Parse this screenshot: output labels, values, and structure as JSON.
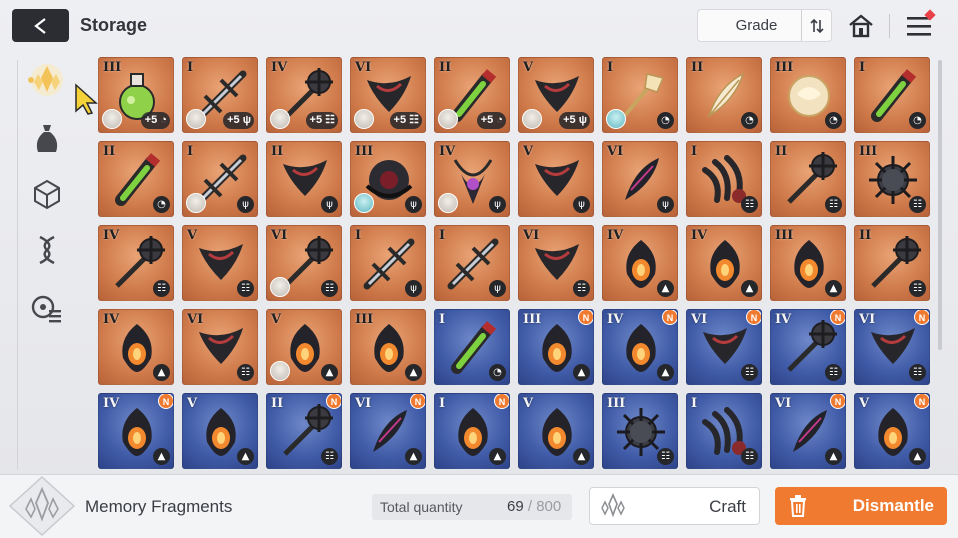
{
  "header": {
    "title": "Storage",
    "sort_label": "Grade"
  },
  "sidebar": {
    "items": [
      {
        "name": "memory-fragments-tab",
        "icon": "crystal-icon",
        "active": true
      },
      {
        "name": "bag-tab",
        "icon": "bag-icon",
        "active": false
      },
      {
        "name": "materials-tab",
        "icon": "cube-icon",
        "active": false
      },
      {
        "name": "gene-tab",
        "icon": "dna-icon",
        "active": false
      },
      {
        "name": "misc-tab",
        "icon": "disc-list-icon",
        "active": false
      }
    ]
  },
  "items": [
    {
      "grade": "III",
      "color": "orange",
      "type": "swirl",
      "plus": "+5",
      "avatar": "white",
      "art": "flask"
    },
    {
      "grade": "I",
      "color": "orange",
      "type": "claw",
      "plus": "+5",
      "avatar": "white",
      "art": "blade"
    },
    {
      "grade": "IV",
      "color": "orange",
      "type": "tower",
      "plus": "+5",
      "avatar": "white",
      "art": "mace"
    },
    {
      "grade": "VI",
      "color": "orange",
      "type": "tower",
      "plus": "+5",
      "avatar": "white",
      "art": "wing"
    },
    {
      "grade": "II",
      "color": "orange",
      "type": "swirl",
      "plus": "+5",
      "avatar": "white",
      "art": "vial"
    },
    {
      "grade": "V",
      "color": "orange",
      "type": "claw",
      "plus": "+5",
      "avatar": "white",
      "art": "wing"
    },
    {
      "grade": "I",
      "color": "orange",
      "type": "swirl",
      "plus": "",
      "avatar": "teal",
      "art": "staff"
    },
    {
      "grade": "II",
      "color": "orange",
      "type": "swirl",
      "plus": "",
      "avatar": "",
      "art": "feather"
    },
    {
      "grade": "III",
      "color": "orange",
      "type": "swirl",
      "plus": "",
      "avatar": "",
      "art": "orb"
    },
    {
      "grade": "I",
      "color": "orange",
      "type": "swirl",
      "plus": "",
      "avatar": "",
      "art": "vial"
    },
    {
      "grade": "II",
      "color": "orange",
      "type": "swirl",
      "plus": "",
      "avatar": "",
      "art": "vial"
    },
    {
      "grade": "I",
      "color": "orange",
      "type": "claw",
      "plus": "",
      "avatar": "white",
      "art": "blade"
    },
    {
      "grade": "II",
      "color": "orange",
      "type": "claw",
      "plus": "",
      "avatar": "",
      "art": "wing"
    },
    {
      "grade": "III",
      "color": "orange",
      "type": "claw",
      "plus": "",
      "avatar": "teal",
      "art": "orb-dark"
    },
    {
      "grade": "IV",
      "color": "orange",
      "type": "claw",
      "plus": "",
      "avatar": "white",
      "art": "chain"
    },
    {
      "grade": "V",
      "color": "orange",
      "type": "claw",
      "plus": "",
      "avatar": "",
      "art": "wing"
    },
    {
      "grade": "VI",
      "color": "orange",
      "type": "claw",
      "plus": "",
      "avatar": "",
      "art": "feather-dark"
    },
    {
      "grade": "I",
      "color": "orange",
      "type": "tower",
      "plus": "",
      "avatar": "",
      "art": "claw"
    },
    {
      "grade": "II",
      "color": "orange",
      "type": "tower",
      "plus": "",
      "avatar": "",
      "art": "mace"
    },
    {
      "grade": "III",
      "color": "orange",
      "type": "tower",
      "plus": "",
      "avatar": "",
      "art": "spikeball"
    },
    {
      "grade": "IV",
      "color": "orange",
      "type": "tower",
      "plus": "",
      "avatar": "",
      "art": "mace"
    },
    {
      "grade": "V",
      "color": "orange",
      "type": "tower",
      "plus": "",
      "avatar": "",
      "art": "wing"
    },
    {
      "grade": "VI",
      "color": "orange",
      "type": "tower",
      "plus": "",
      "avatar": "white",
      "art": "mace"
    },
    {
      "grade": "I",
      "color": "orange",
      "type": "claw",
      "plus": "",
      "avatar": "",
      "art": "blade"
    },
    {
      "grade": "I",
      "color": "orange",
      "type": "claw",
      "plus": "",
      "avatar": "",
      "art": "blade"
    },
    {
      "grade": "VI",
      "color": "orange",
      "type": "tower",
      "plus": "",
      "avatar": "",
      "art": "wing"
    },
    {
      "grade": "IV",
      "color": "orange",
      "type": "flame",
      "plus": "",
      "avatar": "",
      "art": "lantern"
    },
    {
      "grade": "IV",
      "color": "orange",
      "type": "flame",
      "plus": "",
      "avatar": "",
      "art": "lantern"
    },
    {
      "grade": "III",
      "color": "orange",
      "type": "flame",
      "plus": "",
      "avatar": "",
      "art": "lantern"
    },
    {
      "grade": "II",
      "color": "orange",
      "type": "tower",
      "plus": "",
      "avatar": "",
      "art": "mace"
    },
    {
      "grade": "IV",
      "color": "orange",
      "type": "flame",
      "plus": "",
      "avatar": "",
      "art": "lantern"
    },
    {
      "grade": "VI",
      "color": "orange",
      "type": "tower",
      "plus": "",
      "avatar": "",
      "art": "wing"
    },
    {
      "grade": "V",
      "color": "orange",
      "type": "flame",
      "plus": "",
      "avatar": "white",
      "art": "lantern"
    },
    {
      "grade": "III",
      "color": "orange",
      "type": "flame",
      "plus": "",
      "avatar": "",
      "art": "lantern"
    },
    {
      "grade": "I",
      "color": "blue",
      "type": "swirl",
      "plus": "",
      "avatar": "",
      "art": "vial",
      "new": false
    },
    {
      "grade": "III",
      "color": "blue",
      "type": "flame",
      "plus": "",
      "avatar": "",
      "art": "lantern",
      "new": true
    },
    {
      "grade": "IV",
      "color": "blue",
      "type": "flame",
      "plus": "",
      "avatar": "",
      "art": "lantern",
      "new": true
    },
    {
      "grade": "VI",
      "color": "blue",
      "type": "tower",
      "plus": "",
      "avatar": "",
      "art": "wing",
      "new": true
    },
    {
      "grade": "IV",
      "color": "blue",
      "type": "tower",
      "plus": "",
      "avatar": "",
      "art": "mace",
      "new": true
    },
    {
      "grade": "VI",
      "color": "blue",
      "type": "tower",
      "plus": "",
      "avatar": "",
      "art": "wing",
      "new": true
    },
    {
      "grade": "IV",
      "color": "blue",
      "type": "flame",
      "plus": "",
      "avatar": "",
      "art": "lantern",
      "new": true
    },
    {
      "grade": "V",
      "color": "blue",
      "type": "flame",
      "plus": "",
      "avatar": "",
      "art": "lantern",
      "new": false
    },
    {
      "grade": "II",
      "color": "blue",
      "type": "tower",
      "plus": "",
      "avatar": "",
      "art": "mace",
      "new": true
    },
    {
      "grade": "VI",
      "color": "blue",
      "type": "flame",
      "plus": "",
      "avatar": "",
      "art": "feather-dark",
      "new": true
    },
    {
      "grade": "I",
      "color": "blue",
      "type": "flame",
      "plus": "",
      "avatar": "",
      "art": "lantern",
      "new": true
    },
    {
      "grade": "V",
      "color": "blue",
      "type": "flame",
      "plus": "",
      "avatar": "",
      "art": "lantern",
      "new": false
    },
    {
      "grade": "III",
      "color": "blue",
      "type": "tower",
      "plus": "",
      "avatar": "",
      "art": "spikeball",
      "new": false
    },
    {
      "grade": "I",
      "color": "blue",
      "type": "tower",
      "plus": "",
      "avatar": "",
      "art": "claw",
      "new": false
    },
    {
      "grade": "VI",
      "color": "blue",
      "type": "flame",
      "plus": "",
      "avatar": "",
      "art": "feather-dark",
      "new": true
    },
    {
      "grade": "V",
      "color": "blue",
      "type": "flame",
      "plus": "",
      "avatar": "",
      "art": "lantern",
      "new": true
    }
  ],
  "badges": {
    "new": "N"
  },
  "footer": {
    "category_label": "Memory Fragments",
    "total_label": "Total quantity",
    "total_current": "69",
    "total_separator": " / ",
    "total_max": "800",
    "craft_label": "Craft",
    "dismantle_label": "Dismantle"
  },
  "colors": {
    "accent": "#f07a2f",
    "orange_tile": "#cf7a4a",
    "blue_tile": "#3f5aa6"
  }
}
